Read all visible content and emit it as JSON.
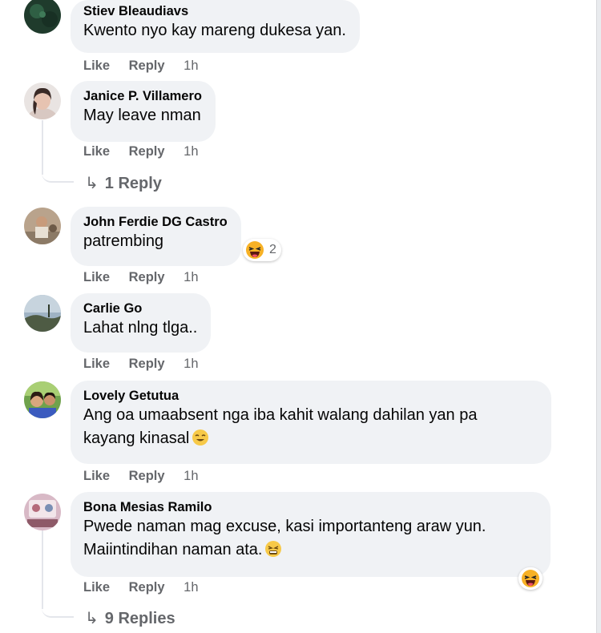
{
  "comments": [
    {
      "author": "Stiev Bleaudiavs",
      "text": "Kwento nyo kay mareng dukesa yan.",
      "like": "Like",
      "reply": "Reply",
      "time": "1h"
    },
    {
      "author": "Janice P. Villamero",
      "text": "May leave nman",
      "like": "Like",
      "reply": "Reply",
      "time": "1h",
      "replies_label": "1 Reply"
    },
    {
      "author": "John Ferdie DG Castro",
      "text": "patrembing",
      "like": "Like",
      "reply": "Reply",
      "time": "1h",
      "reaction_count": "2"
    },
    {
      "author": "Carlie Go",
      "text": "Lahat nlng tlga..",
      "like": "Like",
      "reply": "Reply",
      "time": "1h"
    },
    {
      "author": "Lovely Getutua",
      "text_line1": "Ang oa umaabsent nga iba kahit walang dahilan yan pa",
      "text_line2": "kayang kinasal",
      "like": "Like",
      "reply": "Reply",
      "time": "1h"
    },
    {
      "author": "Bona Mesias Ramilo",
      "text_line1": "Pwede naman mag excuse, kasi importanteng araw yun.",
      "text_line2": "Maiintindihan naman ata.",
      "like": "Like",
      "reply": "Reply",
      "time": "1h",
      "replies_label": "9 Replies"
    }
  ],
  "icons": {
    "reply_arrow": "reply-arrow-icon",
    "haha": "haha-reaction-icon",
    "smile": "smiling-face-emoji",
    "grimace": "tired-face-emoji"
  },
  "colors": {
    "bubble": "#f0f2f5",
    "secondary_text": "#65676b",
    "reaction_yellow": "#f7b125"
  }
}
